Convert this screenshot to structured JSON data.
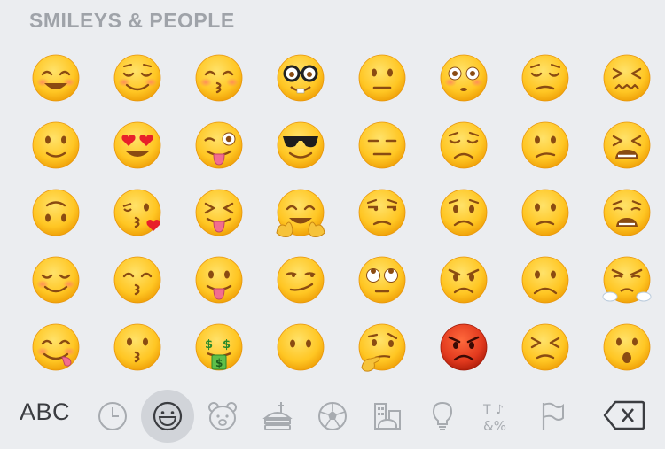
{
  "keyboard": {
    "section_title": "SMILEYS & PEOPLE",
    "abc_label": "ABC",
    "selected_category": "smileys",
    "colors": {
      "background": "#ebedf0",
      "title": "#9fa3a9",
      "icon_gray": "#a7abb0",
      "selected_bg": "#d1d4d9"
    }
  },
  "emojis": [
    [
      "smiling-face-with-smiling-eyes",
      "relieved-face",
      "kissing-face-with-smiling-eyes",
      "nerd-face",
      "neutral-face",
      "flushed-face",
      "pensive-face",
      "confounded-face"
    ],
    [
      "slightly-smiling-face",
      "smiling-face-with-heart-eyes",
      "winking-face-with-tongue",
      "smiling-face-with-sunglasses",
      "expressionless-face",
      "disappointed-face",
      "confused-face",
      "tired-face"
    ],
    [
      "upside-down-face",
      "face-blowing-a-kiss",
      "squinting-face-with-tongue",
      "hugging-face",
      "unamused-face",
      "worried-face",
      "slightly-frowning-face",
      "weary-face"
    ],
    [
      "smiling-face",
      "kissing-face-with-closed-eyes",
      "face-with-tongue",
      "smirking-face",
      "face-with-rolling-eyes",
      "angry-face",
      "frowning-face",
      "face-with-steam-from-nose"
    ],
    [
      "face-savoring-food",
      "kissing-face",
      "money-mouth-face",
      "face-without-mouth",
      "thinking-face",
      "pouting-face",
      "persevering-face",
      "face-with-open-mouth"
    ]
  ],
  "categories": [
    "recent-clock-icon",
    "smileys-icon",
    "animals-icon",
    "food-icon",
    "activity-icon",
    "travel-icon",
    "objects-icon",
    "symbols-icon",
    "flags-icon"
  ]
}
